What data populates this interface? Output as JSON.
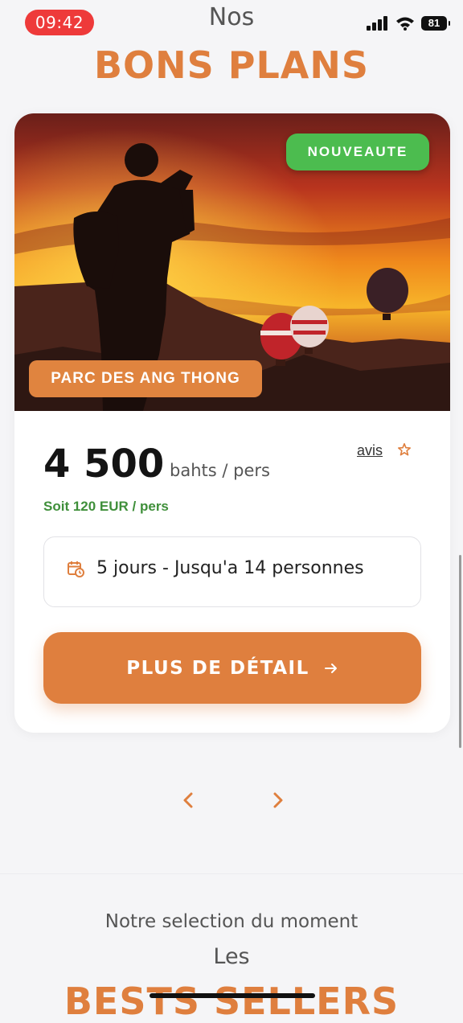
{
  "status_bar": {
    "time": "09:42",
    "battery": "81"
  },
  "header": {
    "small": "Nos",
    "title": "BONS PLANS"
  },
  "card": {
    "badge_new": "NOUVEAUTE",
    "place": "PARC DES ANG THONG",
    "price": "4 500",
    "unit": "bahts / pers",
    "reviews_link": "avis",
    "conversion": "Soit 120 EUR / pers",
    "info": "5 jours - Jusqu'a 14 personnes",
    "detail_button": "PLUS DE DÉTAIL"
  },
  "section": {
    "subtitle": "Notre selection du moment",
    "small": "Les",
    "title": "BESTS SELLERS"
  },
  "colors": {
    "accent": "#df7f3e",
    "green": "#4cbc4f",
    "status_red": "#ee3a3a"
  }
}
